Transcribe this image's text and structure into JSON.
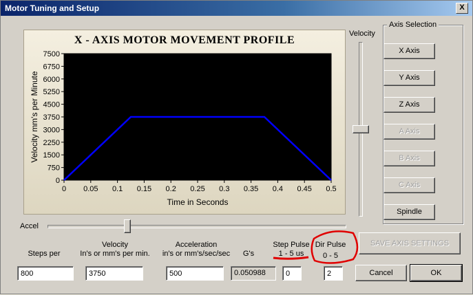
{
  "window": {
    "title": "Motor Tuning and Setup",
    "close_glyph": "X"
  },
  "chart_data": {
    "type": "line",
    "title": "X - AXIS MOTOR MOVEMENT PROFILE",
    "xlabel": "Time in Seconds",
    "ylabel": "Velocity mm's per Minute",
    "xlim": [
      0,
      0.5
    ],
    "ylim": [
      0,
      7500
    ],
    "x_ticks": [
      "0",
      "0.05",
      "0.1",
      "0.15",
      "0.2",
      "0.25",
      "0.3",
      "0.35",
      "0.4",
      "0.45",
      "0.5"
    ],
    "y_ticks": [
      "7500",
      "6750",
      "6000",
      "5250",
      "4500",
      "3750",
      "3000",
      "2250",
      "1500",
      "750",
      "0"
    ],
    "series": [
      {
        "color": "#0000ff",
        "x": [
          0,
          0.125,
          0.375,
          0.5
        ],
        "y": [
          0,
          3750,
          3750,
          0
        ]
      }
    ],
    "background": "#000000",
    "grid": false
  },
  "velocity_slider": {
    "label": "Velocity"
  },
  "accel_slider": {
    "label": "Accel"
  },
  "axis_selection": {
    "label": "Axis Selection",
    "buttons": [
      {
        "label": "X Axis",
        "enabled": true
      },
      {
        "label": "Y Axis",
        "enabled": true
      },
      {
        "label": "Z Axis",
        "enabled": true
      },
      {
        "label": "A Axis",
        "enabled": false
      },
      {
        "label": "B Axis",
        "enabled": false
      },
      {
        "label": "C Axis",
        "enabled": false
      },
      {
        "label": "Spindle",
        "enabled": true
      }
    ]
  },
  "fields": {
    "steps_per": {
      "label": "Steps per",
      "value": "800"
    },
    "velocity": {
      "label_line1": "Velocity",
      "label_line2": "In's or mm's per min.",
      "value": "3750"
    },
    "acceleration": {
      "label_line1": "Acceleration",
      "label_line2": "in's or mm's/sec/sec",
      "value": "500"
    },
    "gs": {
      "label": "G's",
      "value": "0.050988"
    },
    "step_pulse": {
      "label_line1": "Step Pulse",
      "label_line2": "1 - 5 us",
      "value": "0"
    },
    "dir_pulse": {
      "label_line1": "Dir Pulse",
      "label_line2": "0 - 5",
      "value": "2"
    }
  },
  "buttons": {
    "save": "SAVE AXIS SETTINGS",
    "cancel": "Cancel",
    "ok": "OK"
  },
  "annotation_color": "#e00000"
}
